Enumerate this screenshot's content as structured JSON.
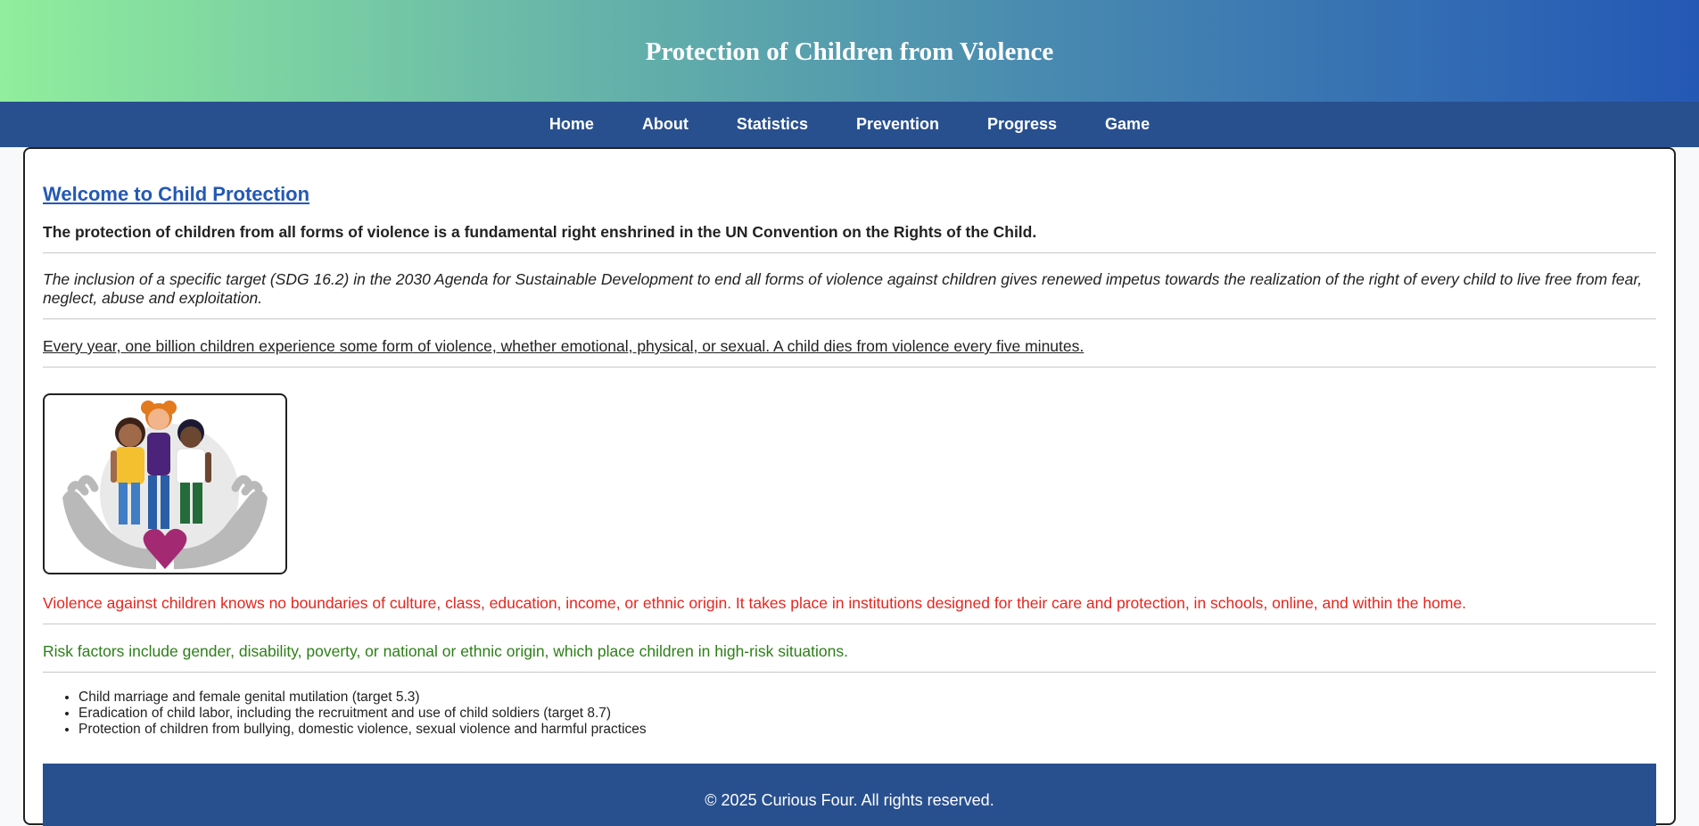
{
  "header": {
    "title": "Protection of Children from Violence"
  },
  "nav": {
    "items": [
      {
        "label": "Home"
      },
      {
        "label": "About"
      },
      {
        "label": "Statistics"
      },
      {
        "label": "Prevention"
      },
      {
        "label": "Progress"
      },
      {
        "label": "Game"
      }
    ]
  },
  "main": {
    "heading": "Welcome to Child Protection",
    "intro": "The protection of children from all forms of violence is a fundamental right enshrined in the UN Convention on the Rights of the Child.",
    "sdg_text": "The inclusion of a specific target (SDG 16.2) in the 2030 Agenda for Sustainable Development to end all forms of violence against children gives renewed impetus towards the realization of the right of every child to live free from fear, neglect, abuse and exploitation.",
    "stat_text": "Every year, one billion children experience some form of violence, whether emotional, physical, or sexual. A child dies from violence every five minutes.",
    "image_icon": "children-in-hands-illustration",
    "boundaries_text": "Violence against children knows no boundaries of culture, class, education, income, or ethnic origin. It takes place in institutions designed for their care and protection, in schools, online, and within the home.",
    "risk_text": "Risk factors include gender, disability, poverty, or national or ethnic origin, which place children in high-risk situations.",
    "list": [
      "Child marriage and female genital mutilation (target 5.3)",
      "Eradication of child labor, including the recruitment and use of child soldiers (target 8.7)",
      "Protection of children from bullying, domestic violence, sexual violence and harmful practices"
    ]
  },
  "footer": {
    "text": "© 2025 Curious Four. All rights reserved."
  },
  "colors": {
    "nav_bg": "#28508f",
    "heading": "#2458b5",
    "red_text": "#e6261f",
    "green_text": "#2d7f18"
  }
}
